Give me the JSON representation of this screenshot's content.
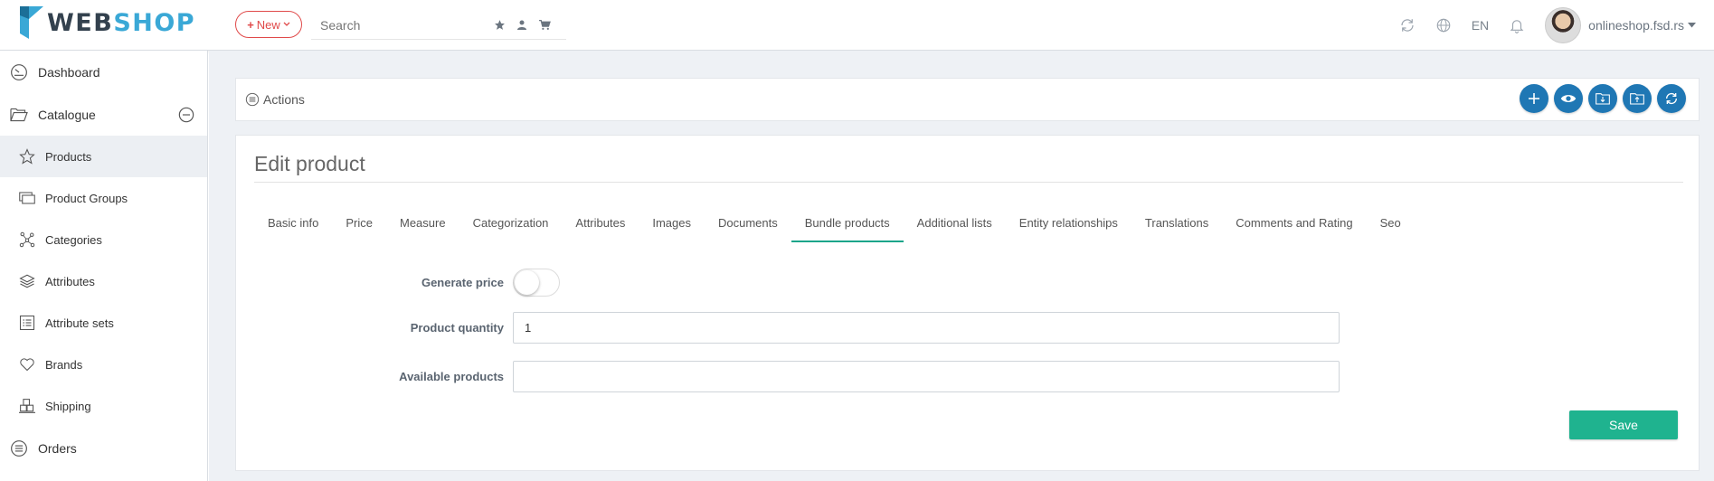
{
  "brand": {
    "part1": "WEB",
    "part2": "SHOP"
  },
  "topbar": {
    "new_label": "New",
    "search_placeholder": "Search",
    "language": "EN",
    "user_name": "onlineshop.fsd.rs"
  },
  "sidebar": {
    "items": [
      {
        "label": "Dashboard",
        "icon": "dashboard-icon"
      },
      {
        "label": "Catalogue",
        "icon": "folder-open-icon"
      },
      {
        "label": "Products",
        "icon": "star-icon"
      },
      {
        "label": "Product Groups",
        "icon": "product-groups-icon"
      },
      {
        "label": "Categories",
        "icon": "categories-icon"
      },
      {
        "label": "Attributes",
        "icon": "layers-icon"
      },
      {
        "label": "Attribute sets",
        "icon": "list-icon"
      },
      {
        "label": "Brands",
        "icon": "heart-icon"
      },
      {
        "label": "Shipping",
        "icon": "shipping-icon"
      },
      {
        "label": "Orders",
        "icon": "orders-icon"
      }
    ]
  },
  "actions": {
    "label": "Actions"
  },
  "panel": {
    "title": "Edit product",
    "tabs": [
      "Basic info",
      "Price",
      "Measure",
      "Categorization",
      "Attributes",
      "Images",
      "Documents",
      "Bundle products",
      "Additional lists",
      "Entity relationships",
      "Translations",
      "Comments and Rating",
      "Seo"
    ],
    "active_tab": "Bundle products",
    "form": {
      "generate_price_label": "Generate price",
      "generate_price_on": false,
      "quantity_label": "Product quantity",
      "quantity_value": "1",
      "available_label": "Available products",
      "available_value": ""
    },
    "save_label": "Save"
  },
  "colors": {
    "accent_blue": "#1f77b4",
    "accent_green": "#1fb38f",
    "new_red": "#e04a4a",
    "tab_underline": "#1aa58a"
  }
}
